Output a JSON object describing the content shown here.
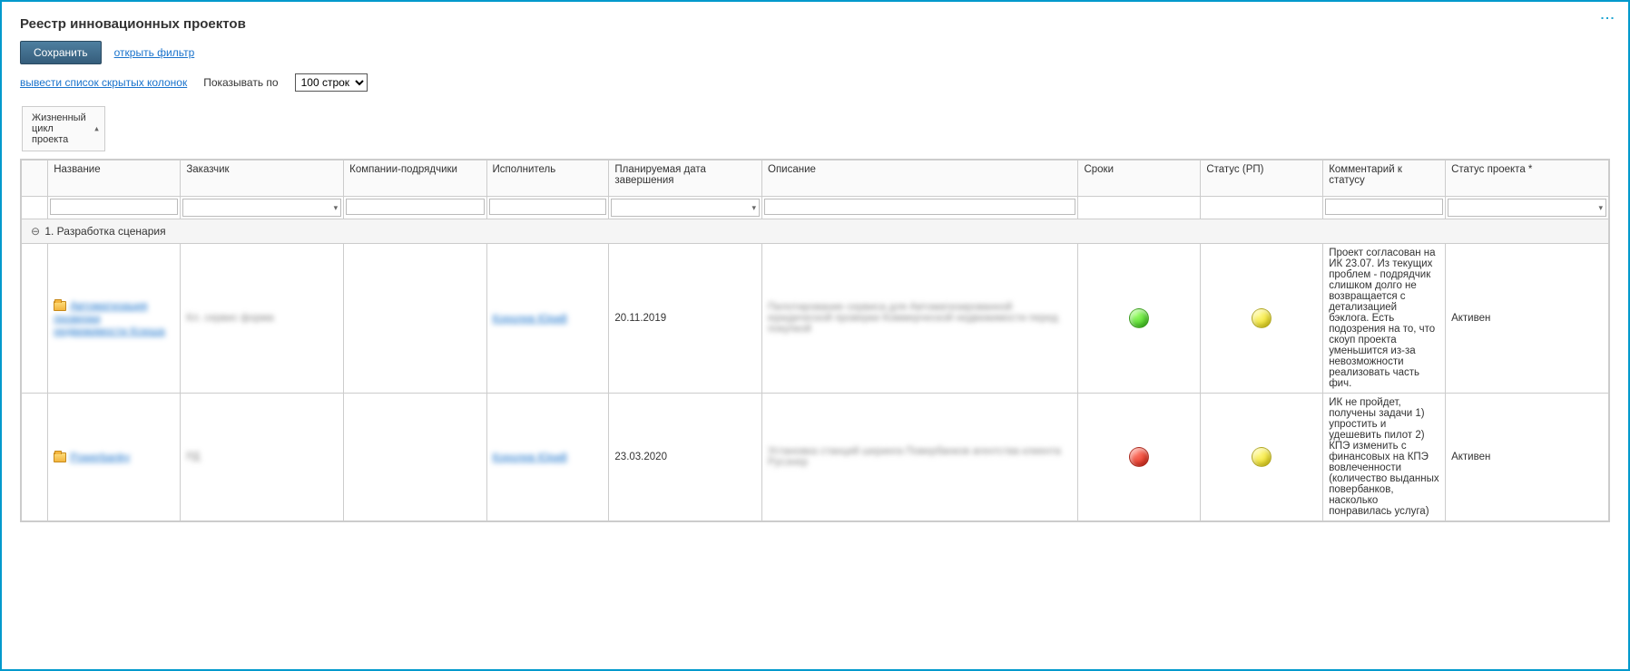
{
  "page": {
    "title": "Реестр инновационных проектов"
  },
  "toolbar": {
    "save_label": "Сохранить",
    "open_filter": "открыть фильтр"
  },
  "subtoolbar": {
    "hidden_cols_link": "вывести список скрытых колонок",
    "show_by_label": "Показывать по",
    "rows_select_value": "100 строк"
  },
  "group_header": {
    "label": "Жизненный\nцикл\nпроекта"
  },
  "columns": {
    "name": "Название",
    "customer": "Заказчик",
    "contractors": "Компании-подрядчики",
    "executor": "Исполнитель",
    "plan_date": "Планируемая дата завершения",
    "description": "Описание",
    "sroki": "Сроки",
    "status_rp": "Статус (РП)",
    "comment": "Комментарий к статусу",
    "project_status": "Статус проекта *"
  },
  "group_row": {
    "title": "1. Разработка сценария"
  },
  "rows": [
    {
      "name_blur": "Автоматизация проверки недвижимости Ксюша",
      "customer_blur": "Кл. сервис форма",
      "contractors": "",
      "executor_blur": "Королев Юрий",
      "plan_date": "20.11.2019",
      "description_blur": "Пилотирование сервиса для Автоматизированной юридической проверки Коммерческой недвижимости перед покупкой",
      "sroki_color": "green",
      "status_rp_color": "yellow",
      "comment": "Проект согласован на ИК 23.07. Из текущих проблем - подрядчик слишком долго не возвращается с детализацией бэклога. Есть подозрения на то, что скоуп проекта уменьшится из-за невозможности реализовать часть фич.",
      "project_status": "Активен"
    },
    {
      "name_blur": "Powerbanky",
      "customer_blur": "РД",
      "contractors": "",
      "executor_blur": "Королев Юрий",
      "plan_date": "23.03.2020",
      "description_blur": "Установка станций шеринга Повербанков агентства клиента Русэнер",
      "sroki_color": "red",
      "status_rp_color": "yellow",
      "comment": "ИК не пройдет, получены задачи 1) упростить и удешевить пилот 2) КПЭ изменить с финансовых на КПЭ вовлеченности (количество выданных повербанков, насколько понравилась услуга)",
      "project_status": "Активен"
    }
  ]
}
